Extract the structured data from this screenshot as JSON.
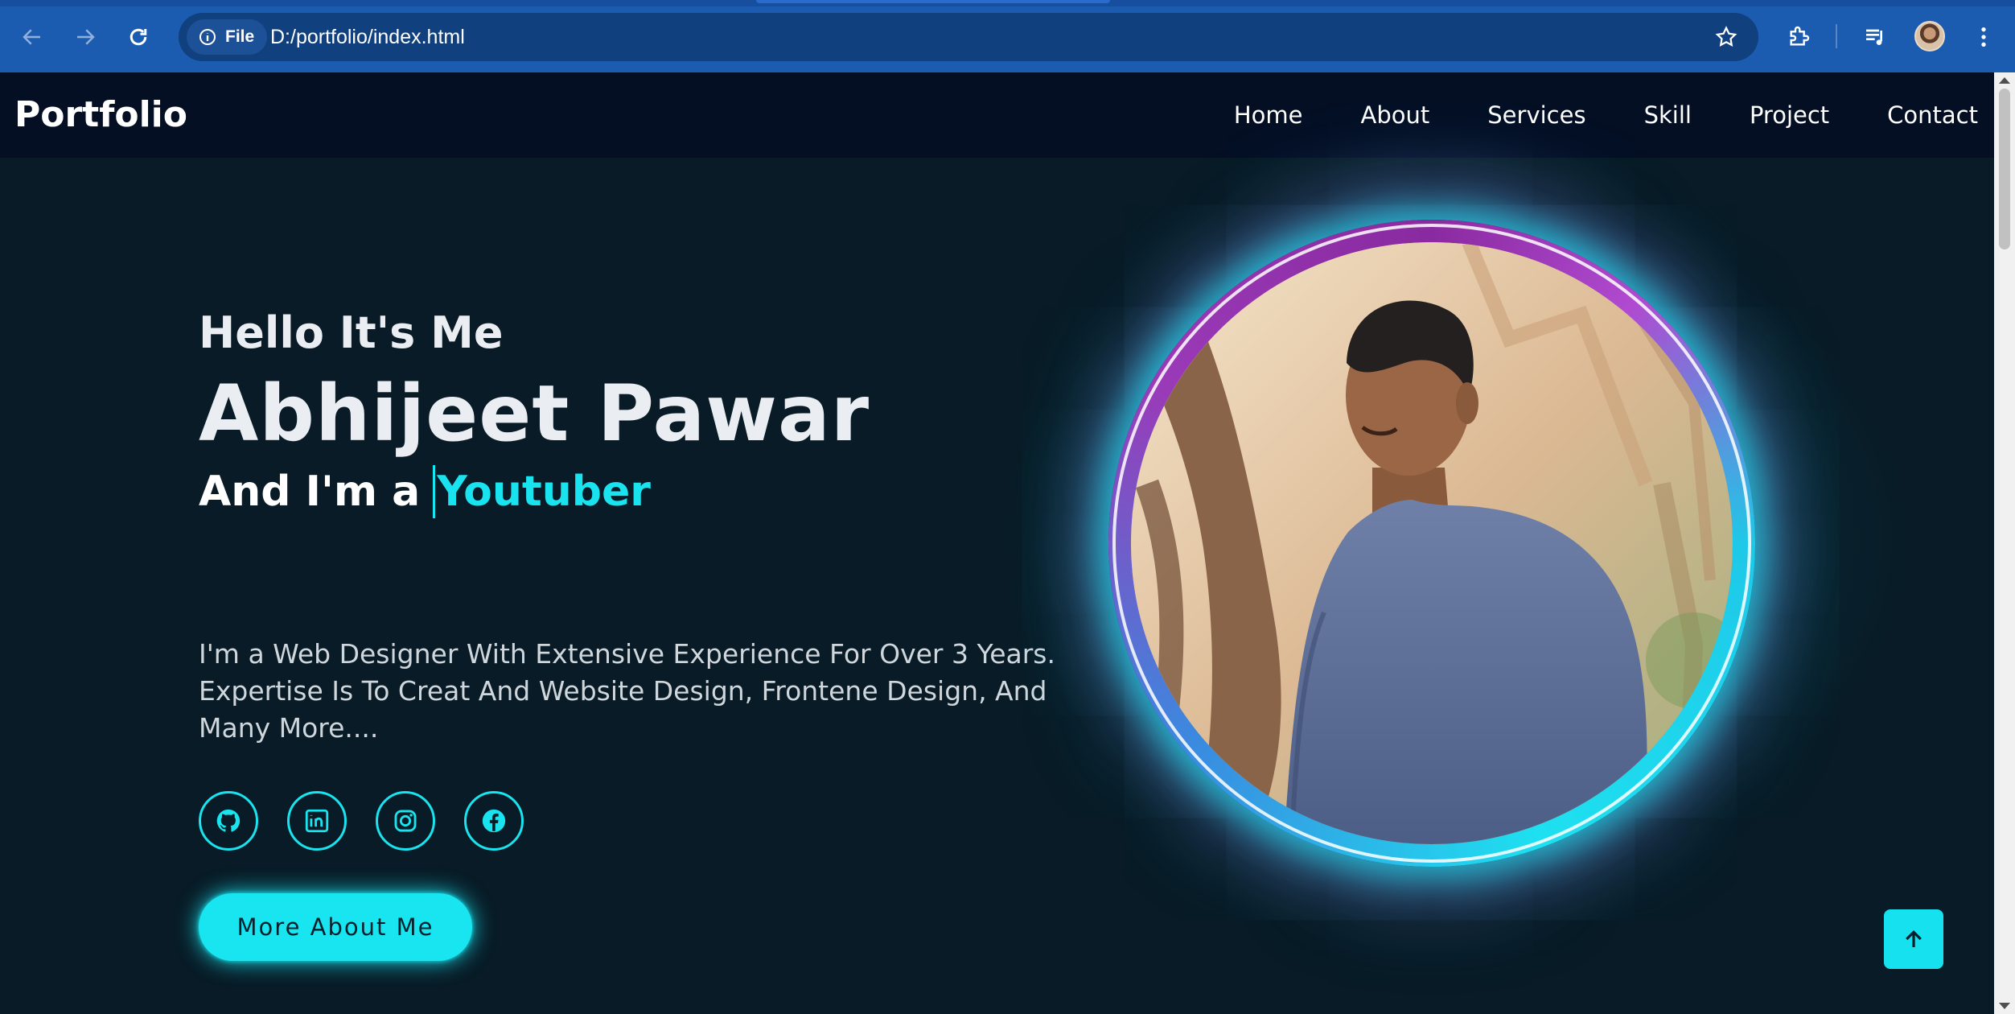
{
  "browser": {
    "file_chip_label": "File",
    "url": "D:/portfolio/index.html"
  },
  "site": {
    "logo": "Portfolio",
    "nav": [
      "Home",
      "About",
      "Services",
      "Skill",
      "Project",
      "Contact"
    ]
  },
  "hero": {
    "greeting": "Hello It's Me",
    "name": "Abhijeet Pawar",
    "role_prefix": "And I'm a",
    "role_typed": "Youtuber",
    "bio": "I'm a Web Designer With Extensive Experience For Over 3 Years. Expertise Is To Creat And Website Design, Frontene Design, And Many More....",
    "socials": [
      "github-icon",
      "linkedin-icon",
      "instagram-icon",
      "facebook-icon"
    ],
    "cta_label": "More About Me"
  },
  "colors": {
    "accent": "#19e3ee",
    "header_bg": "#040f24",
    "page_bg": "#081b26",
    "browser_bar": "#1b5bb0"
  }
}
